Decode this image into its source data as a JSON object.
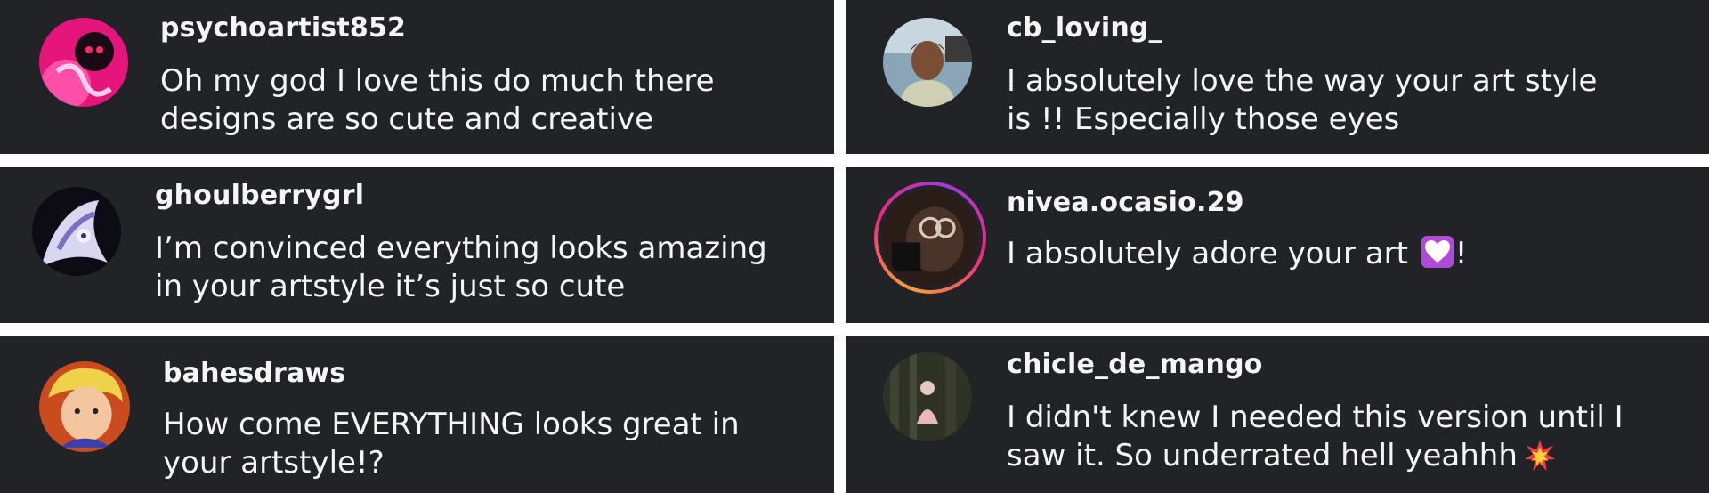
{
  "comments": [
    {
      "username": "psychoartist852",
      "lines": [
        "Oh my god I love this do much there",
        "designs are so cute and creative"
      ]
    },
    {
      "username": "cb_loving_",
      "lines": [
        "I absolutely love the way your art style",
        "is !! Especially those eyes"
      ]
    },
    {
      "username": "ghoulberrygrl",
      "lines": [
        "I’m convinced everything looks amazing",
        "in your artstyle it’s just so cute"
      ]
    },
    {
      "username": "nivea.ocasio.29",
      "lines": [
        "I absolutely adore your art",
        "!"
      ],
      "emoji": "purple-heart"
    },
    {
      "username": "bahesdraws",
      "lines": [
        "How come EVERYTHING looks great in",
        "your artstyle!?"
      ]
    },
    {
      "username": "chicle_de_mango",
      "lines": [
        "I didn't knew I needed this version until I",
        "saw it. So underrated hell yeahhh"
      ],
      "emoji": "collision"
    }
  ],
  "colors": {
    "card_bg": "#222327",
    "text": "#f5f5f5",
    "story_ring": [
      "#f9a23a",
      "#ee2a7b",
      "#a23bdc"
    ]
  }
}
